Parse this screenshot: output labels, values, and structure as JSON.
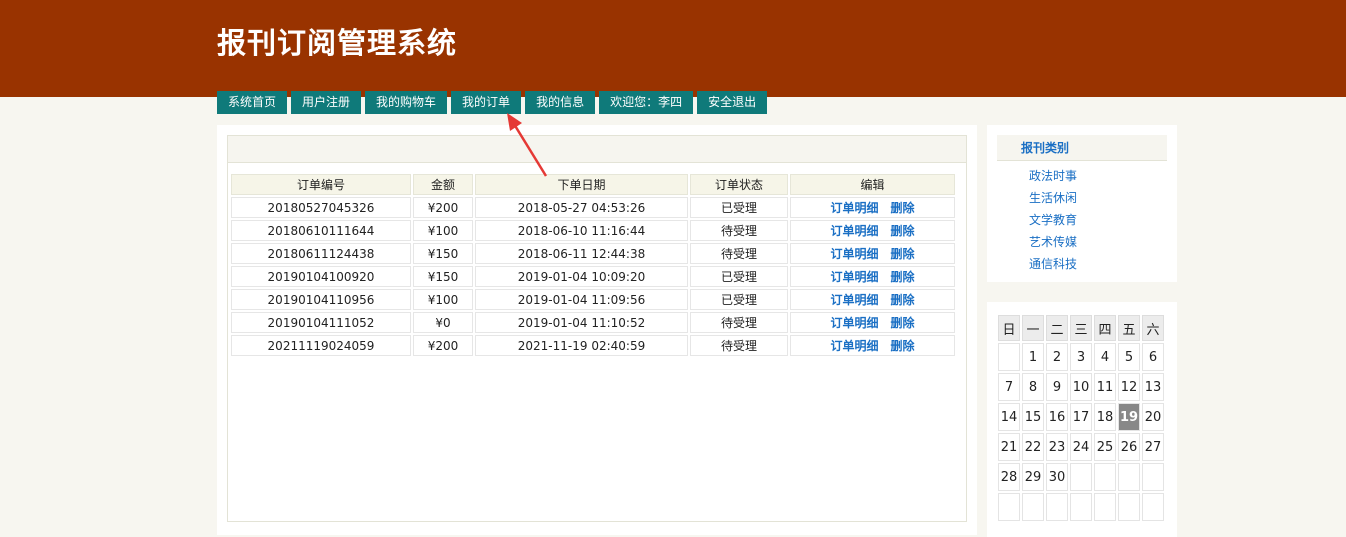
{
  "header": {
    "title": "报刊订阅管理系统"
  },
  "nav": [
    {
      "label": "系统首页"
    },
    {
      "label": "用户注册"
    },
    {
      "label": "我的购物车"
    },
    {
      "label": "我的订单"
    },
    {
      "label": "我的信息"
    },
    {
      "label": "欢迎您：李四"
    },
    {
      "label": "安全退出"
    }
  ],
  "orders": {
    "columns": [
      "订单编号",
      "金额",
      "下单日期",
      "订单状态",
      "编辑"
    ],
    "detail_label": "订单明细",
    "delete_label": "删除",
    "rows": [
      {
        "id": "20180527045326",
        "amount": "¥200",
        "date": "2018-05-27 04:53:26",
        "status": "已受理"
      },
      {
        "id": "20180610111644",
        "amount": "¥100",
        "date": "2018-06-10 11:16:44",
        "status": "待受理"
      },
      {
        "id": "20180611124438",
        "amount": "¥150",
        "date": "2018-06-11 12:44:38",
        "status": "待受理"
      },
      {
        "id": "20190104100920",
        "amount": "¥150",
        "date": "2019-01-04 10:09:20",
        "status": "已受理"
      },
      {
        "id": "20190104110956",
        "amount": "¥100",
        "date": "2019-01-04 11:09:56",
        "status": "已受理"
      },
      {
        "id": "20190104111052",
        "amount": "¥0",
        "date": "2019-01-04 11:10:52",
        "status": "待受理"
      },
      {
        "id": "20211119024059",
        "amount": "¥200",
        "date": "2021-11-19 02:40:59",
        "status": "待受理"
      }
    ]
  },
  "categories": {
    "title": "报刊类别",
    "items": [
      "政法时事",
      "生活休闲",
      "文学教育",
      "艺术传媒",
      "通信科技"
    ]
  },
  "calendar": {
    "weekdays": [
      "日",
      "一",
      "二",
      "三",
      "四",
      "五",
      "六"
    ],
    "weeks": [
      [
        "",
        "1",
        "2",
        "3",
        "4",
        "5",
        "6"
      ],
      [
        "7",
        "8",
        "9",
        "10",
        "11",
        "12",
        "13"
      ],
      [
        "14",
        "15",
        "16",
        "17",
        "18",
        "19",
        "20"
      ],
      [
        "21",
        "22",
        "23",
        "24",
        "25",
        "26",
        "27"
      ],
      [
        "28",
        "29",
        "30",
        "",
        "",
        "",
        ""
      ],
      [
        "",
        "",
        "",
        "",
        "",
        "",
        ""
      ]
    ],
    "today": "19"
  },
  "colors": {
    "header_bg": "#993300",
    "nav_bg": "#0f7a7a",
    "link": "#1a6fc4",
    "annotation_arrow": "#e53935"
  }
}
